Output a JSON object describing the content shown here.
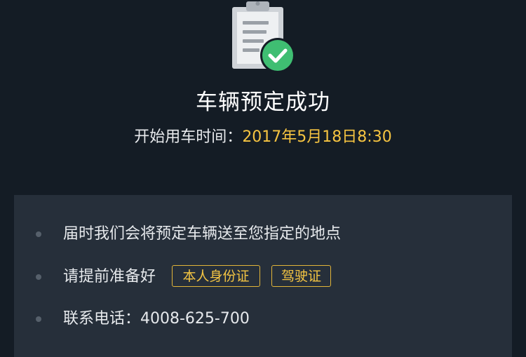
{
  "booking": {
    "title": "车辆预定成功",
    "start_label": "开始用车时间：",
    "start_value": "2017年5月18日8:30"
  },
  "notes": {
    "delivery": "届时我们会将预定车辆送至您指定的地点",
    "prepare_label": "请提前准备好",
    "documents": [
      "本人身份证",
      "驾驶证"
    ],
    "contact": "联系电话：4008-625-700"
  },
  "colors": {
    "background": "#141c25",
    "panel": "#262f3a",
    "accent": "#f6c441",
    "success": "#3fbe72"
  },
  "icons": {
    "hero": "clipboard-check-icon",
    "bullet": "bullet-dot-icon"
  }
}
